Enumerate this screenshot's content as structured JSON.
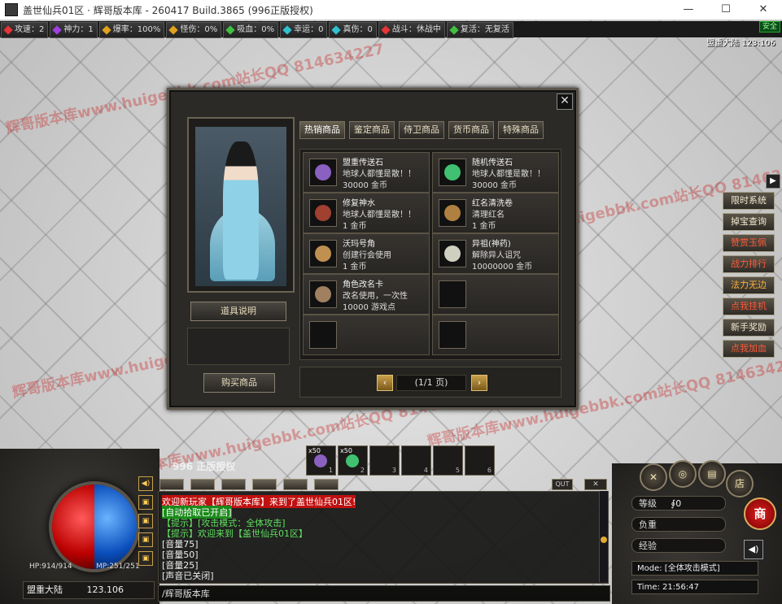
{
  "window": {
    "title": "盖世仙兵01区 · 辉哥版本库 - 260417 Build.3865 (996正版授权)",
    "min": "—",
    "max": "☐",
    "close": "✕"
  },
  "stats": [
    {
      "label": "攻速：2",
      "color": "#e53535"
    },
    {
      "label": "神力：1",
      "color": "#a040e0"
    },
    {
      "label": "爆率：100%",
      "color": "#e0a020"
    },
    {
      "label": "怪伤：0%",
      "color": "#e0a020"
    },
    {
      "label": "吸血：0%",
      "color": "#40c040"
    },
    {
      "label": "幸运：0",
      "color": "#30c0d0"
    },
    {
      "label": "真伤：0",
      "color": "#30c0d0"
    },
    {
      "label": "战斗：休战中",
      "color": "#e53535"
    },
    {
      "label": "复活：无复活",
      "color": "#40c040"
    }
  ],
  "safe_label": "安全",
  "map_title": "盟重大陆  123:106",
  "watermark_text": "辉哥版本库www.huigebbk.com站长QQ 814634227",
  "shop": {
    "close": "✕",
    "desc_button": "道具说明",
    "buy_button": "购买商品",
    "tabs": [
      "热销商品",
      "鉴定商品",
      "侍卫商品",
      "货币商品",
      "特殊商品"
    ],
    "items": [
      {
        "name": "盟重传送石",
        "desc": "地球人都懂是散！！",
        "price": "30000 金币",
        "gem": "#8a60c0"
      },
      {
        "name": "随机传送石",
        "desc": "地球人都懂是散！！",
        "price": "30000 金币",
        "gem": "#40c070"
      },
      {
        "name": "修复神水",
        "desc": "地球人都懂是散！！",
        "price": "1 金币",
        "gem": "#a04030"
      },
      {
        "name": "红名清洗卷",
        "desc": "清理红名",
        "price": "1 金币",
        "gem": "#b08040"
      },
      {
        "name": "沃玛号角",
        "desc": "创建行会使用",
        "price": "1 金币",
        "gem": "#c09050"
      },
      {
        "name": "异祖(神药)",
        "desc": "解除异人诅咒",
        "price": "10000000 金币",
        "gem": "#d0d0c0"
      },
      {
        "name": "角色改名卡",
        "desc": "改名使用，一次性",
        "price": "10000 游戏点",
        "gem": "#a08060"
      },
      {
        "name": "",
        "desc": "",
        "price": "",
        "gem": ""
      },
      {
        "name": "",
        "desc": "",
        "price": "",
        "gem": ""
      },
      {
        "name": "",
        "desc": "",
        "price": "",
        "gem": ""
      }
    ],
    "prev": "‹",
    "next": "›",
    "page_label": "(1/1 页)"
  },
  "side_menu": [
    {
      "label": "限时系统",
      "tone": ""
    },
    {
      "label": "掉宝查询",
      "tone": ""
    },
    {
      "label": "赞赏玉佩",
      "tone": "red"
    },
    {
      "label": "战力排行",
      "tone": "red"
    },
    {
      "label": "法力无边",
      "tone": "orange"
    },
    {
      "label": "点我挂机",
      "tone": "red"
    },
    {
      "label": "新手奖励",
      "tone": ""
    },
    {
      "label": "点我加血",
      "tone": "red"
    }
  ],
  "side_toggle": "▶",
  "hotbar": [
    {
      "count": "x50",
      "key": "1",
      "gem": "#8a60c0"
    },
    {
      "count": "x50",
      "key": "2",
      "gem": "#40c070"
    },
    {
      "count": "",
      "key": "3",
      "gem": ""
    },
    {
      "count": "",
      "key": "4",
      "gem": ""
    },
    {
      "count": "",
      "key": "5",
      "gem": ""
    },
    {
      "count": "",
      "key": "6",
      "gem": ""
    }
  ],
  "logo_text": "996 正版授权",
  "hp_text": "HP:914/914",
  "mp_text": "MP:251/251",
  "location": {
    "map": "盟重大陆",
    "coords": "123.106"
  },
  "chat": {
    "qut": "QUT",
    "close": "✕",
    "lines": [
      {
        "text": "欢迎新玩家【辉哥版本库】来到了盖世仙兵01区!",
        "color": "#ffffff",
        "bg": "#c01010"
      },
      {
        "text": "[自动拾取已开启]",
        "color": "#ffffff",
        "bg": "#1a8a1a"
      },
      {
        "text": "【提示】[攻击模式：全体攻击]",
        "color": "#5fe05f",
        "bg": ""
      },
      {
        "text": "【提示】欢迎来到【盖世仙兵01区】",
        "color": "#5fe05f",
        "bg": ""
      },
      {
        "text": "[音量75]",
        "color": "#eeeeee",
        "bg": ""
      },
      {
        "text": "[音量50]",
        "color": "#eeeeee",
        "bg": ""
      },
      {
        "text": "[音量25]",
        "color": "#eeeeee",
        "bg": ""
      },
      {
        "text": "[声音已关闭]",
        "color": "#eeeeee",
        "bg": ""
      }
    ],
    "input": "/辉哥版本库"
  },
  "right_hud": {
    "level_label": "等级",
    "level_value": "∮0",
    "weight_label": "负重",
    "exp_label": "经验",
    "mode": "Mode: [全体攻击模式]",
    "time": "Time: 21:56:47",
    "shop_icon": "商",
    "sound_icon": "◀)",
    "round_icons": [
      "✕",
      "◎",
      "▤",
      "店"
    ]
  },
  "left_icons": [
    "◀)",
    "▣",
    "▣",
    "▣",
    "▣"
  ]
}
